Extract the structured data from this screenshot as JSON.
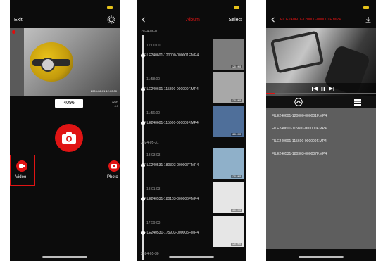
{
  "live_screen": {
    "exit_label": "Exit",
    "resolution_value": "4096",
    "live_timestamp": "2024-06-01 12:00:00",
    "side_labels": [
      "720P",
      "4:3"
    ],
    "video_mode_label": "Video",
    "photo_mode_label": "Photo"
  },
  "album_screen": {
    "title": "Album",
    "select_label": "Select",
    "groups": [
      {
        "date": "2024-06-01",
        "items": [
          {
            "time": "12:00:00",
            "filename": "FILE240601-120000-000001F.MP4",
            "size": "128.0MB",
            "tone": "#7d7d7d"
          },
          {
            "time": "11:58:00",
            "filename": "FILE240601-115800-000000F.MP4",
            "size": "128.0MB",
            "tone": "#a8a8a8"
          },
          {
            "time": "11:56:00",
            "filename": "FILE240601-115600-000009F.MP4",
            "size": "128.0MB",
            "tone": "#4f6f9a"
          }
        ]
      },
      {
        "date": "2024-05-31",
        "items": [
          {
            "time": "18:03:03",
            "filename": "FILE240531-180303-000007F.MP4",
            "size": "128.0MB",
            "tone": "#8fb0c9"
          },
          {
            "time": "18:01:03",
            "filename": "FILE240531-180103-000006F.MP4",
            "size": "128.0MB",
            "tone": "#e6e6e6"
          },
          {
            "time": "17:59:03",
            "filename": "FILE240531-175903-000005F.MP4",
            "size": "128.0MB",
            "tone": "#e6e6e6"
          }
        ]
      }
    ],
    "bottom_date": "2024-05-30"
  },
  "player_screen": {
    "title": "FILE240601-120000-000001F.MP4",
    "playback_progress": 0.08,
    "playlist": [
      "FILE240601-120000-000001F.MP4",
      "FILE240601-115800-000000F.MP4",
      "FILE240601-115600-000009F.MP4",
      "FILE240531-180303-000007F.MP4"
    ]
  },
  "colors": {
    "accent": "#e01414",
    "battery": "#e6c21a",
    "background": "#0c0c0c",
    "playlist_bg": "#5e5e5e"
  },
  "icons": [
    "settings-icon",
    "camera-icon",
    "video-mode-icon",
    "photo-mode-icon",
    "back-icon",
    "download-icon",
    "prev-icon",
    "pause-icon",
    "next-icon",
    "chevron-up-icon",
    "list-icon"
  ]
}
